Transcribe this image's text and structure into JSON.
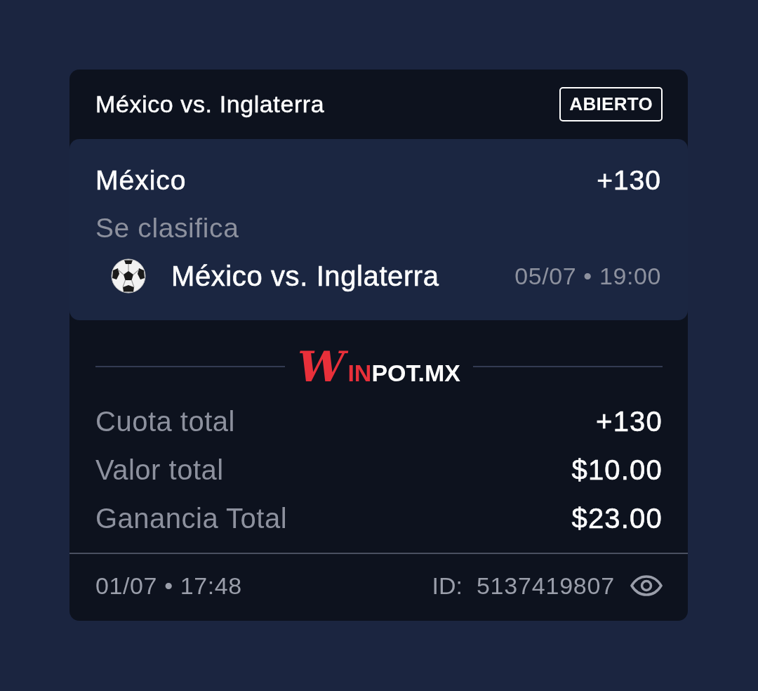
{
  "header": {
    "title": "México vs. Inglaterra",
    "status": "ABIERTO"
  },
  "selection": {
    "pick": "México",
    "odds": "+130",
    "market": "Se clasifica",
    "event": "México vs. Inglaterra",
    "event_time": "05/07 • 19:00"
  },
  "logo": {
    "parts": [
      {
        "text": "W",
        "kind": "script"
      },
      {
        "text": "IN",
        "kind": "accent"
      },
      {
        "text": "POT.MX",
        "kind": "plain"
      }
    ]
  },
  "summary": [
    {
      "label": "Cuota total",
      "value": "+130"
    },
    {
      "label": "Valor total",
      "value": "$10.00"
    },
    {
      "label": "Ganancia Total",
      "value": "$23.00"
    }
  ],
  "footer": {
    "placed": "01/07 • 17:48",
    "id_label": "ID:",
    "id": "5137419807"
  }
}
